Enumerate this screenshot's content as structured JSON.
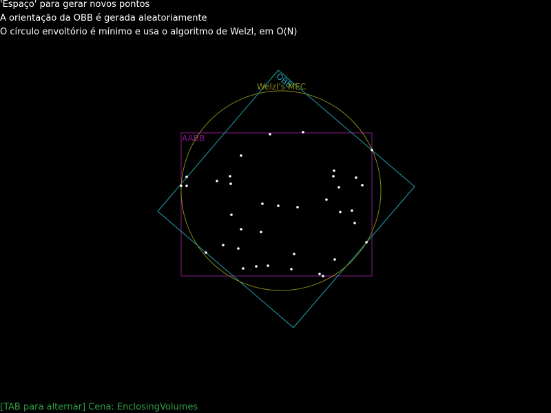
{
  "instructions": [
    "'Espaço' para gerar novos pontos",
    "A orientação da OBB é gerada aleatoriamente",
    "O círculo envoltório é mínimo e usa o algoritmo de Welzl, em O(N)"
  ],
  "status": "[TAB para alternar] Cena: EnclosingVolumes",
  "labels": {
    "aabb": "AABB",
    "obb": "OBB",
    "mec": "Welzl's MEC"
  },
  "colors": {
    "background": "#000000",
    "text": "#ffffff",
    "status": "#2ea043",
    "aabb": "#8a1a8a",
    "obb": "#1fa3b0",
    "mec": "#8c8c14",
    "point": "#ffffff"
  }
}
